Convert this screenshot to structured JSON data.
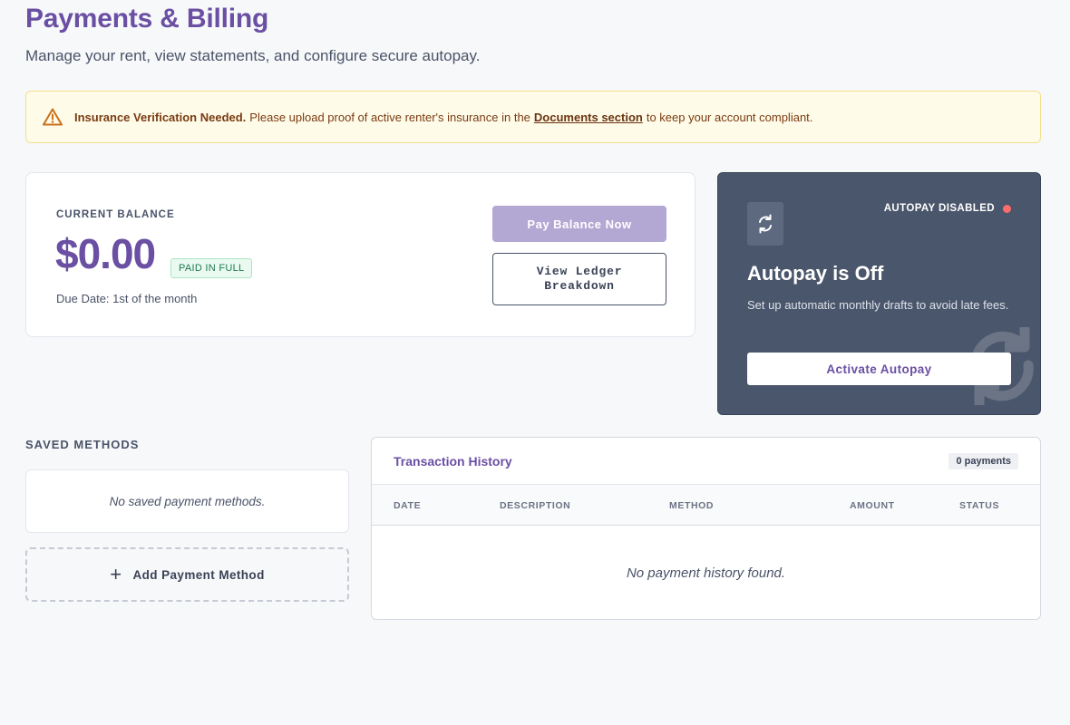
{
  "header": {
    "title": "Payments & Billing",
    "subtitle": "Manage your rent, view statements, and configure secure autopay."
  },
  "alert": {
    "icon": "warning-triangle-icon",
    "strong": "Insurance Verification Needed.",
    "text_before": "Please upload proof of active renter's insurance in the",
    "link": "Documents section",
    "text_after": "to keep your account compliant."
  },
  "balance": {
    "label": "CURRENT BALANCE",
    "amount": "$0.00",
    "badge": "PAID IN FULL",
    "due_date": "Due Date: 1st of the month",
    "pay_button": "Pay Balance Now",
    "ledger_button": "View Ledger Breakdown"
  },
  "autopay": {
    "icon": "sync-icon",
    "status": "AUTOPAY DISABLED",
    "status_color": "#ff6b6b",
    "title": "Autopay is Off",
    "description": "Set up automatic monthly drafts to avoid late fees.",
    "button": "Activate Autopay"
  },
  "saved_methods": {
    "heading": "SAVED METHODS",
    "empty": "No saved payment methods.",
    "add_button": "Add Payment Method"
  },
  "transactions": {
    "title": "Transaction History",
    "count": "0 payments",
    "columns": [
      "DATE",
      "DESCRIPTION",
      "METHOD",
      "AMOUNT",
      "STATUS"
    ],
    "empty": "No payment history found."
  },
  "colors": {
    "brand": "#6a4fa3",
    "autopay_card": "#4a566b",
    "alert_bg": "#fefbe8"
  }
}
